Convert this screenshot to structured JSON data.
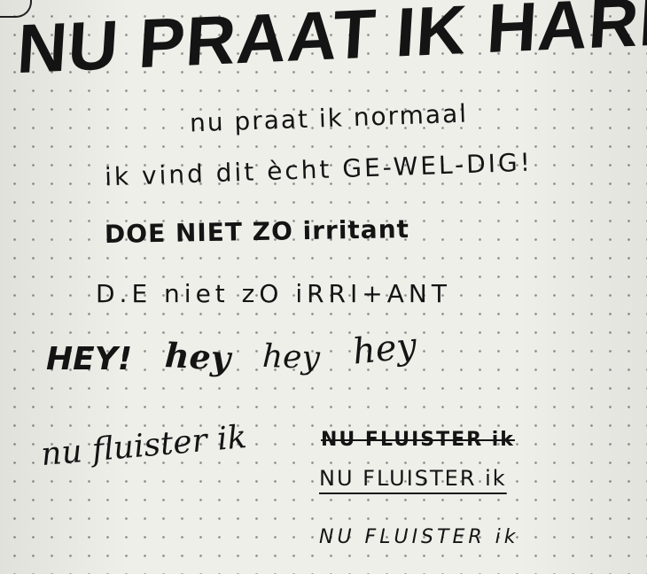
{
  "notebook": {
    "title": "NU PRAAT IK HARD!",
    "lines": {
      "normal": "nu praat ik normaal",
      "geweldig": "ik vind dit ècht GE-WEL-DIG!",
      "doe_bold": "DOE NIET ZO irritant",
      "doe_spaced": "D.E niet zO iRRI+ANT",
      "hey_bold": "HEY!",
      "hey_1": "hey",
      "hey_2": "hey",
      "hey_3": "hey",
      "fluister_script": "nu fluister ik",
      "fluister_struck": "NU FLUISTER ik",
      "fluister_underlined": "NU FLUISTER ik",
      "fluister_plain": "NU FLUISTER ik"
    }
  }
}
